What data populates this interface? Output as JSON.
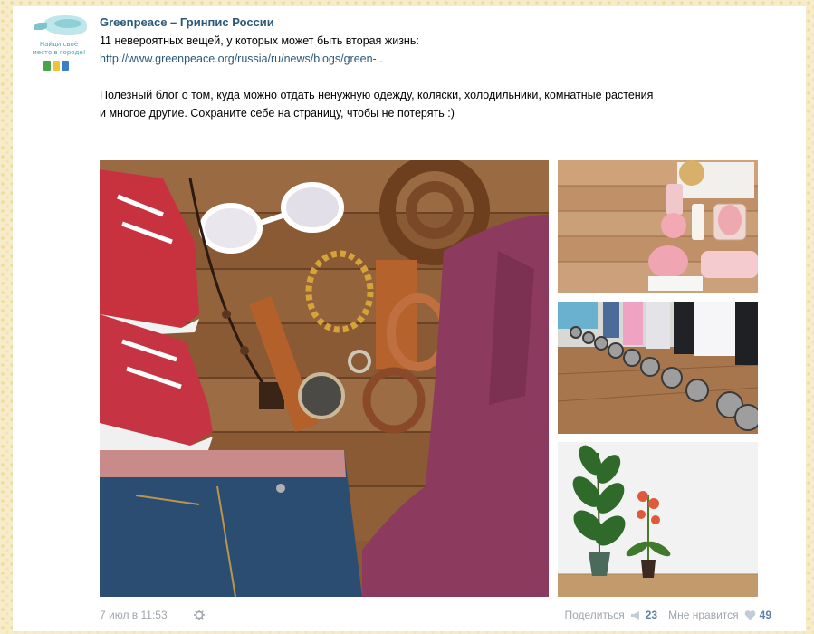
{
  "post": {
    "author": "Greenpeace – Гринпис России",
    "avatar_tagline": "Найди своё место в городе!",
    "line1": "11 невероятных вещей, у которых может быть вторая жизнь:",
    "link": "http://www.greenpeace.org/russia/ru/news/blogs/green-..",
    "body_line1": "Полезный блог о том, куда можно отдать ненужную одежду, коляски, холодильники, комнатные растения",
    "body_line2": "и многое другие. Сохраните себе на страницу, чтобы не потерять :)",
    "date": "7 июл в 11:53",
    "share_label": "Поделиться",
    "share_count": "23",
    "like_label": "Мне нравится",
    "like_count": "49"
  },
  "colors": {
    "author": "#2b587a",
    "meta": "#a0a6ad",
    "count": "#5e81a8",
    "background": "#f6ecc9"
  },
  "icons": {
    "settings": "gear-icon",
    "share": "megaphone-icon",
    "like": "heart-icon"
  }
}
